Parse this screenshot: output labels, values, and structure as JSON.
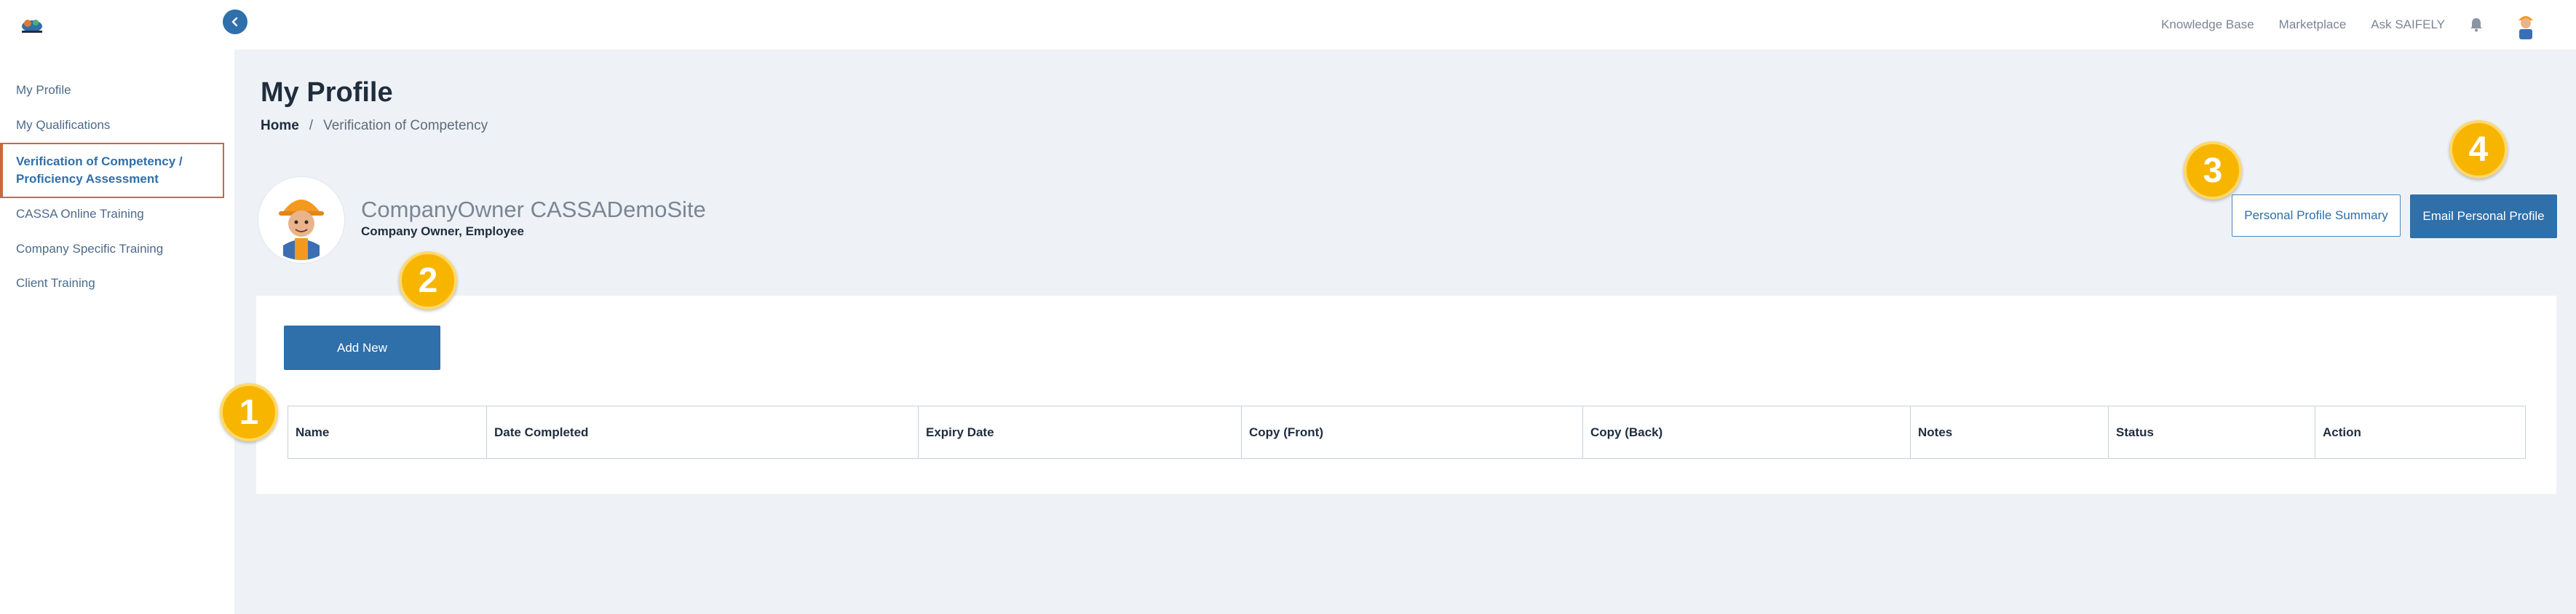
{
  "topnav": {
    "links": [
      "Knowledge Base",
      "Marketplace",
      "Ask SAIFELY"
    ]
  },
  "sidebar": {
    "items": [
      {
        "label": "My Profile"
      },
      {
        "label": "My Qualifications"
      },
      {
        "label": "Verification of Competency / Proficiency Assessment",
        "active": true
      },
      {
        "label": "CASSA Online Training"
      },
      {
        "label": "Company Specific Training"
      },
      {
        "label": "Client Training"
      }
    ]
  },
  "page": {
    "title": "My Profile",
    "breadcrumb": {
      "home": "Home",
      "separator": "/",
      "current": "Verification of Competency"
    }
  },
  "profile": {
    "name": "CompanyOwner CASSADemoSite",
    "roles": "Company Owner, Employee"
  },
  "actions": {
    "summary_label": "Personal Profile Summary",
    "email_label": "Email Personal Profile",
    "add_new_label": "Add New"
  },
  "table": {
    "columns": [
      "Name",
      "Date Completed",
      "Expiry Date",
      "Copy (Front)",
      "Copy (Back)",
      "Notes",
      "Status",
      "Action"
    ]
  },
  "callouts": [
    "1",
    "2",
    "3",
    "4"
  ],
  "colors": {
    "accent": "#2f6faa",
    "active_border": "#c8693c",
    "callout": "#f7b500",
    "main_bg": "#eef2f6"
  },
  "icons": {
    "collapse": "chevron-left-icon",
    "notifications": "bell-icon"
  }
}
